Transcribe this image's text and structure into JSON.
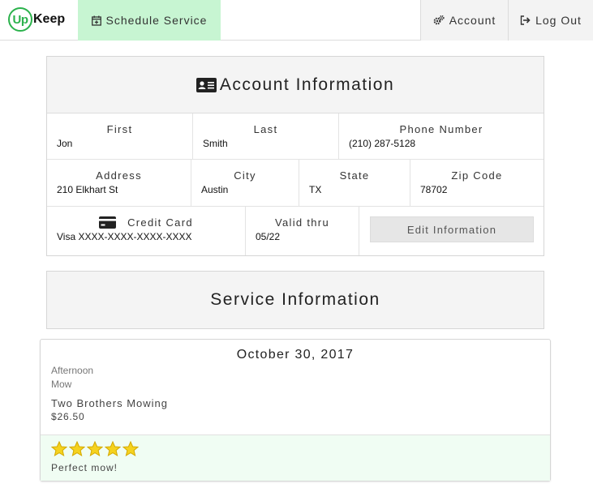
{
  "brand": {
    "circle_text": "Up",
    "rest_text": "Keep",
    "color": "#2bb24c"
  },
  "nav": {
    "schedule_label": "Schedule Service",
    "account_label": "Account",
    "logout_label": "Log Out",
    "schedule_bg": "#c7f5d2"
  },
  "account": {
    "title": "Account Information",
    "first": {
      "label": "First",
      "value": "Jon"
    },
    "last": {
      "label": "Last",
      "value": "Smith"
    },
    "phone": {
      "label": "Phone Number",
      "value": "(210) 287-5128"
    },
    "address": {
      "label": "Address",
      "value": "210 Elkhart St"
    },
    "city": {
      "label": "City",
      "value": "Austin"
    },
    "state": {
      "label": "State",
      "value": "TX"
    },
    "zip": {
      "label": "Zip Code",
      "value": "78702"
    },
    "credit_card": {
      "label": "Credit Card",
      "value": "Visa XXXX-XXXX-XXXX-XXXX"
    },
    "valid_thru": {
      "label": "Valid thru",
      "value": "05/22"
    },
    "edit_button": "Edit Information"
  },
  "service": {
    "title": "Service Information",
    "entries": [
      {
        "date": "October 30, 2017",
        "time": "Afternoon",
        "type": "Mow",
        "provider": "Two Brothers Mowing",
        "price": "$26.50",
        "rating": 5,
        "review": "Perfect mow!"
      }
    ]
  },
  "icons": {
    "schedule": "calendar-plus-icon",
    "account": "gears-icon",
    "logout": "sign-out-icon",
    "account_title": "id-card-icon",
    "credit_card": "credit-card-icon",
    "star": "star-icon"
  },
  "colors": {
    "star": "#f5d21f",
    "star_stroke": "#d4a900",
    "footer_bg": "#f0fdf3"
  }
}
